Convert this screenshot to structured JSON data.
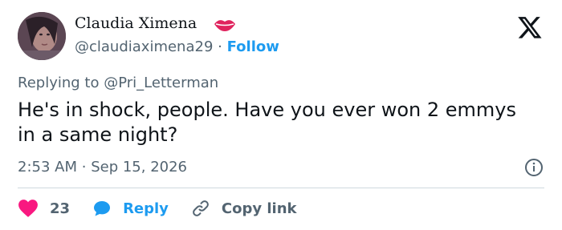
{
  "author": {
    "display_name": "Claudia Ximena",
    "handle": "@claudiaximena29",
    "separator": "·",
    "follow_label": "Follow",
    "emoji_icon": "lips-icon"
  },
  "reply_context": {
    "prefix": "Replying to",
    "target": "@Pri_Letterman"
  },
  "tweet": {
    "text": "He's in shock, people. Have you ever won 2 emmys in a same night?",
    "time": "2:53 AM",
    "separator": "·",
    "date": "Sep 15, 2026"
  },
  "actions": {
    "like_count": "23",
    "reply_label": "Reply",
    "copy_link_label": "Copy link"
  },
  "colors": {
    "accent": "#1d9bf0",
    "like": "#f91880",
    "secondary_text": "#536471",
    "lips": "#e0245e"
  }
}
